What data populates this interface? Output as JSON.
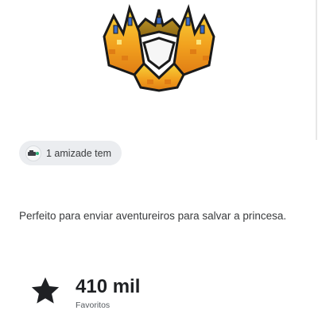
{
  "item": {
    "image_alt": "crown-accessory-image",
    "friends_chip": {
      "text": "1 amizade tem",
      "icon": "friend-avatar-icon"
    },
    "description": "Perfeito para enviar aventureiros para salvar a princesa.",
    "favorites": {
      "value": "410 mil",
      "label": "Favoritos",
      "icon": "star-icon"
    }
  },
  "colors": {
    "gold_light": "#f7c92a",
    "gold_dark": "#e0901a",
    "orange": "#f09a1c",
    "outline": "#1a1a1a",
    "gem_blue": "#3a6cc8",
    "chip_bg": "#ebedf0",
    "text": "#393b3d"
  }
}
